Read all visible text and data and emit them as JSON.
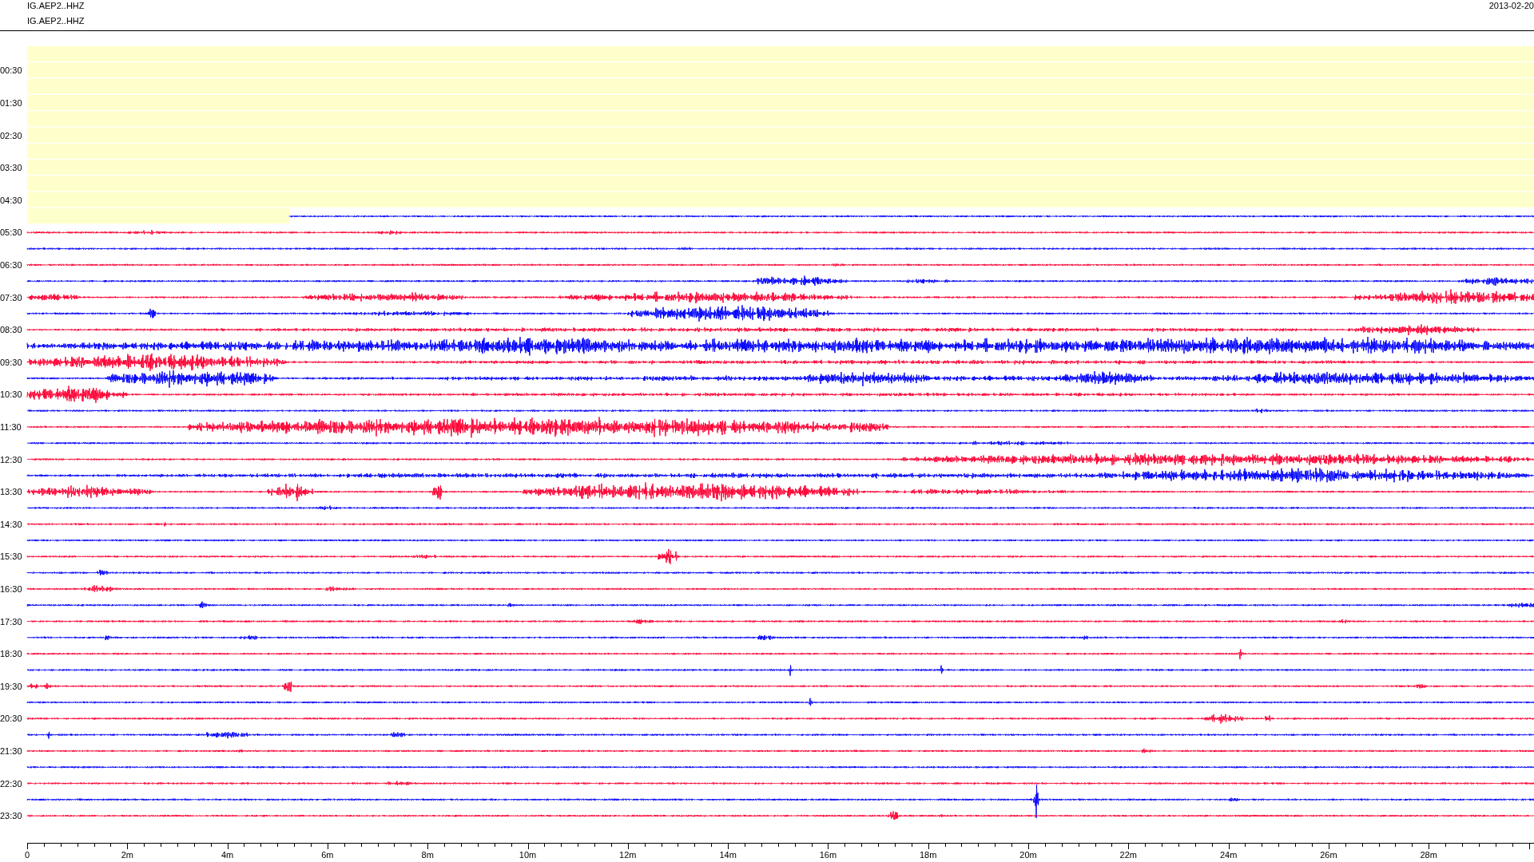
{
  "header": {
    "channel_lines": [
      "IG.AEP2..HHZ",
      "IG.AEP2..HHZ"
    ],
    "date": "2013-02-20"
  },
  "helicorder": {
    "rows": [
      {
        "kind": "no-data"
      },
      {
        "kind": "no-data",
        "label": "00:30"
      },
      {
        "kind": "no-data"
      },
      {
        "kind": "no-data",
        "label": "01:30"
      },
      {
        "kind": "no-data"
      },
      {
        "kind": "no-data",
        "label": "02:30"
      },
      {
        "kind": "no-data"
      },
      {
        "kind": "no-data",
        "label": "03:30"
      },
      {
        "kind": "no-data"
      },
      {
        "kind": "no-data",
        "label": "04:30"
      },
      {
        "kind": "partial",
        "color": "#0000ff"
      },
      {
        "kind": "data",
        "color": "#ff0033",
        "label": "05:30"
      },
      {
        "kind": "data",
        "color": "#0000ff"
      },
      {
        "kind": "data",
        "color": "#ff0033",
        "label": "06:30"
      },
      {
        "kind": "data",
        "color": "#0000ff"
      },
      {
        "kind": "data",
        "color": "#ff0033",
        "label": "07:30"
      },
      {
        "kind": "data",
        "color": "#0000ff"
      },
      {
        "kind": "data",
        "color": "#ff0033",
        "label": "08:30"
      },
      {
        "kind": "data",
        "color": "#0000ff"
      },
      {
        "kind": "data",
        "color": "#ff0033",
        "label": "09:30"
      },
      {
        "kind": "data",
        "color": "#0000ff"
      },
      {
        "kind": "data",
        "color": "#ff0033",
        "label": "10:30"
      },
      {
        "kind": "data",
        "color": "#0000ff"
      },
      {
        "kind": "data",
        "color": "#ff0033",
        "label": "11:30"
      },
      {
        "kind": "data",
        "color": "#0000ff"
      },
      {
        "kind": "data",
        "color": "#ff0033",
        "label": "12:30"
      },
      {
        "kind": "data",
        "color": "#0000ff"
      },
      {
        "kind": "data",
        "color": "#ff0033",
        "label": "13:30"
      },
      {
        "kind": "data",
        "color": "#0000ff"
      },
      {
        "kind": "data",
        "color": "#ff0033",
        "label": "14:30"
      },
      {
        "kind": "data",
        "color": "#0000ff"
      },
      {
        "kind": "data",
        "color": "#ff0033",
        "label": "15:30"
      },
      {
        "kind": "data",
        "color": "#0000ff"
      },
      {
        "kind": "data",
        "color": "#ff0033",
        "label": "16:30"
      },
      {
        "kind": "data",
        "color": "#0000ff"
      },
      {
        "kind": "data",
        "color": "#ff0033",
        "label": "17:30"
      },
      {
        "kind": "data",
        "color": "#0000ff"
      },
      {
        "kind": "data",
        "color": "#ff0033",
        "label": "18:30"
      },
      {
        "kind": "data",
        "color": "#0000ff"
      },
      {
        "kind": "data",
        "color": "#ff0033",
        "label": "19:30"
      },
      {
        "kind": "data",
        "color": "#0000ff"
      },
      {
        "kind": "data",
        "color": "#ff0033",
        "label": "20:30"
      },
      {
        "kind": "data",
        "color": "#0000ff"
      },
      {
        "kind": "data",
        "color": "#ff0033",
        "label": "21:30"
      },
      {
        "kind": "data",
        "color": "#0000ff"
      },
      {
        "kind": "data",
        "color": "#ff0033",
        "label": "22:30"
      },
      {
        "kind": "data",
        "color": "#0000ff"
      },
      {
        "kind": "data",
        "color": "#ff0033",
        "label": "23:30"
      }
    ]
  },
  "x_axis": {
    "labels": [
      "0",
      "2m",
      "4m",
      "6m",
      "8m",
      "10m",
      "12m",
      "14m",
      "16m",
      "18m",
      "20m",
      "22m",
      "24m",
      "26m",
      "28m"
    ]
  }
}
